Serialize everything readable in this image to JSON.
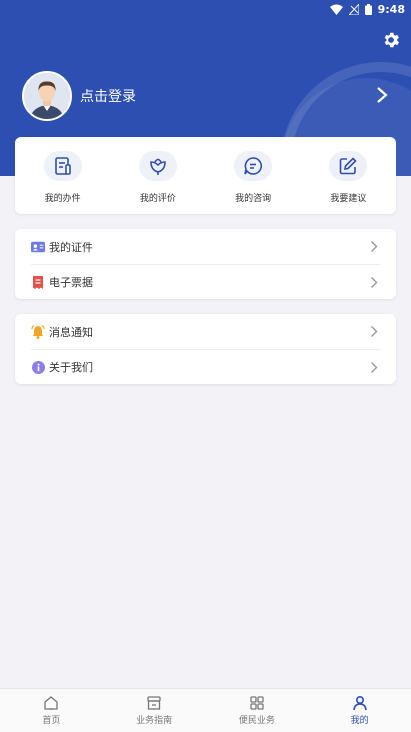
{
  "status": {
    "time": "9:48"
  },
  "profile": {
    "login_text": "点击登录"
  },
  "quick_actions": [
    {
      "label": "我的办件",
      "icon": "document-icon"
    },
    {
      "label": "我的评价",
      "icon": "flower-icon"
    },
    {
      "label": "我的咨询",
      "icon": "chat-icon"
    },
    {
      "label": "我要建议",
      "icon": "edit-icon"
    }
  ],
  "list1": [
    {
      "label": "我的证件",
      "icon": "id-card-icon",
      "color": "#6c79e6"
    },
    {
      "label": "电子票据",
      "icon": "receipt-icon",
      "color": "#e2524b"
    }
  ],
  "list2": [
    {
      "label": "消息通知",
      "icon": "bell-icon",
      "color": "#f3a52b"
    },
    {
      "label": "关于我们",
      "icon": "info-icon",
      "color": "#8b7ee8"
    }
  ],
  "tabs": [
    {
      "label": "首页",
      "icon": "home-icon"
    },
    {
      "label": "业务指南",
      "icon": "store-icon"
    },
    {
      "label": "便民业务",
      "icon": "grid-icon"
    },
    {
      "label": "我的",
      "icon": "person-icon",
      "active": true
    }
  ],
  "colors": {
    "primary": "#2d4fb1",
    "background": "#f3f3f7"
  }
}
